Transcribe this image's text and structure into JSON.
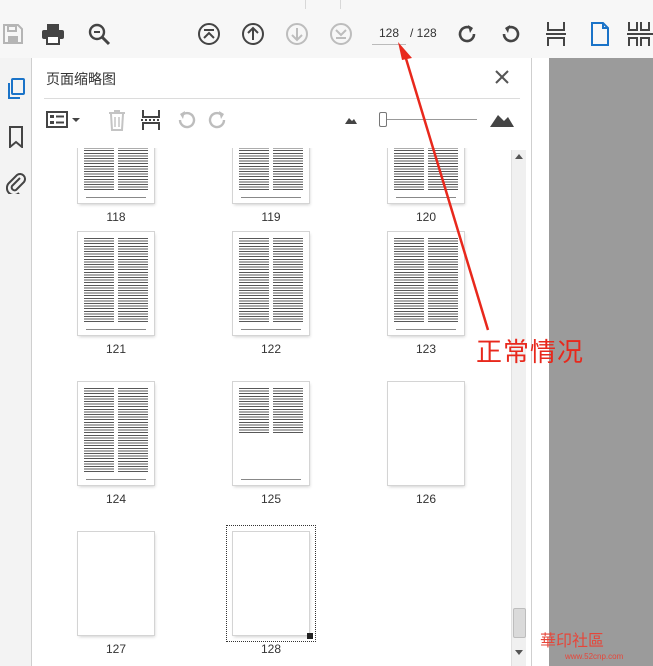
{
  "toolbar": {
    "page_current": "128",
    "page_total": "/ 128",
    "buttons": [
      "save-icon",
      "print-icon",
      "zoom-search-icon",
      "first-page-icon",
      "previous-page-icon",
      "next-page-icon",
      "last-page-icon",
      "rotate-clockwise-icon",
      "rotate-counterclockwise-icon",
      "fit-page-icon",
      "single-page-icon",
      "two-page-icon"
    ]
  },
  "rail": {
    "items": [
      "page-thumbnails-icon",
      "bookmark-icon",
      "attachment-icon"
    ],
    "accent": "#1a73c8"
  },
  "panel": {
    "title": "页面缩略图",
    "toolbar": [
      "options-icon",
      "delete-page-icon",
      "insert-page-icon",
      "undo-icon",
      "redo-icon",
      "small-thumbnail-icon",
      "large-thumbnail-icon"
    ]
  },
  "thumbnails": [
    {
      "label": "118",
      "content": "two-col",
      "partial": true
    },
    {
      "label": "119",
      "content": "two-col",
      "partial": true
    },
    {
      "label": "120",
      "content": "two-col",
      "partial": true
    },
    {
      "label": "121",
      "content": "two-col"
    },
    {
      "label": "122",
      "content": "two-col"
    },
    {
      "label": "123",
      "content": "two-col"
    },
    {
      "label": "124",
      "content": "two-col"
    },
    {
      "label": "125",
      "content": "two-col-half"
    },
    {
      "label": "126",
      "content": "blank"
    },
    {
      "label": "127",
      "content": "blank"
    },
    {
      "label": "128",
      "content": "blank",
      "current": true
    }
  ],
  "annotation": {
    "text": "正常情况",
    "color": "#e8281c"
  },
  "watermark": {
    "brand": "華印社區",
    "url": "www.52cnp.com"
  }
}
